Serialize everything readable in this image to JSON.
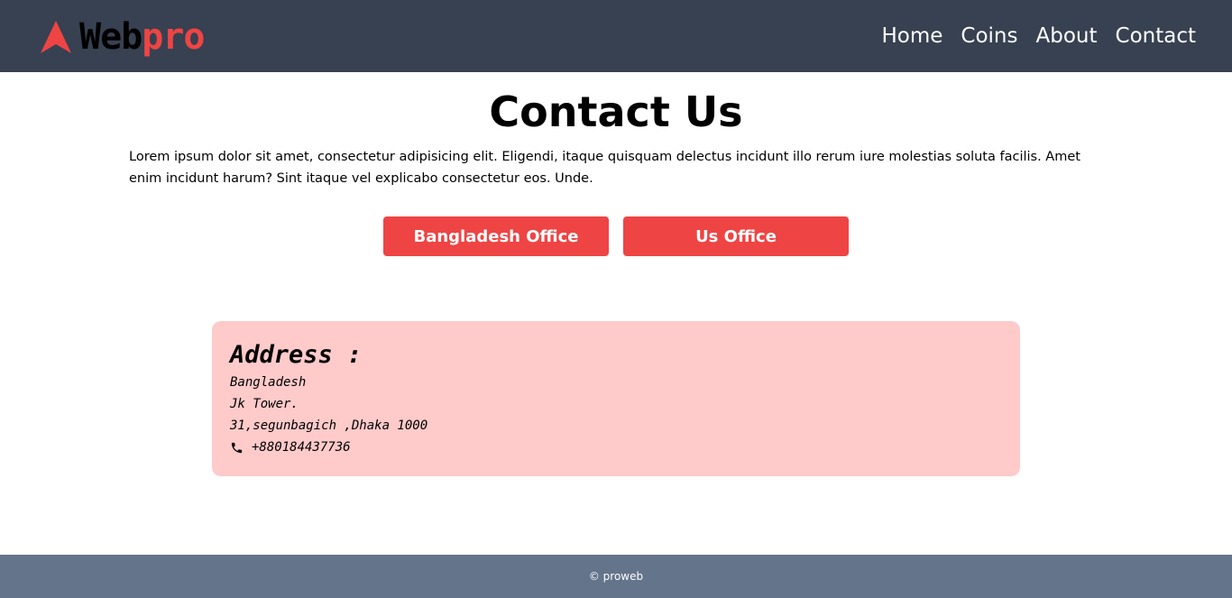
{
  "colors": {
    "nav_bg": "#374151",
    "accent": "#ef4444",
    "card_bg": "#fecaca",
    "footer_bg": "#64748b"
  },
  "brand": {
    "icon": "arrow-up-logo-icon",
    "part1": "Web",
    "part2": "pro"
  },
  "nav": {
    "items": [
      "Home",
      "Coins",
      "About",
      "Contact"
    ]
  },
  "page": {
    "title": "Contact Us",
    "intro": "Lorem ipsum dolor sit amet, consectetur adipisicing elit. Eligendi, itaque quisquam delectus incidunt illo rerum iure molestias soluta facilis. Amet enim incidunt harum? Sint itaque vel explicabo consectetur eos. Unde."
  },
  "offices": {
    "bangladesh_label": "Bangladesh Office",
    "us_label": "Us Office"
  },
  "address": {
    "heading": "Address :",
    "lines": [
      "Bangladesh",
      "Jk Tower.",
      "31,segunbagich ,Dhaka 1000"
    ],
    "phone_icon": "phone-icon",
    "phone": "+880184437736"
  },
  "footer": {
    "text": "© proweb"
  }
}
